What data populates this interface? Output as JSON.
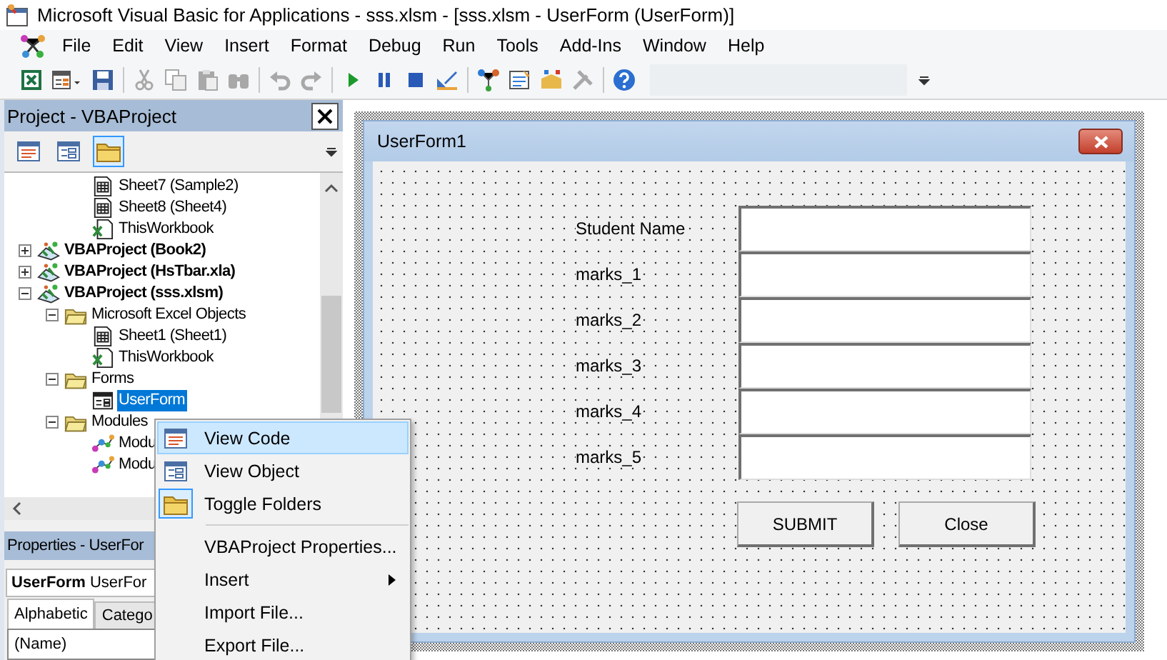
{
  "window": {
    "title": "Microsoft Visual Basic for Applications - sss.xlsm - [sss.xlsm - UserForm (UserForm)]"
  },
  "menu_bar": [
    "File",
    "Edit",
    "View",
    "Insert",
    "Format",
    "Debug",
    "Run",
    "Tools",
    "Add-Ins",
    "Window",
    "Help"
  ],
  "toolbar": [
    {
      "kind": "excel",
      "disabled": false
    },
    {
      "kind": "insert-form",
      "disabled": false
    },
    {
      "kind": "save",
      "disabled": false
    },
    {
      "kind": "separator"
    },
    {
      "kind": "cut",
      "disabled": true
    },
    {
      "kind": "copy",
      "disabled": true
    },
    {
      "kind": "paste",
      "disabled": true
    },
    {
      "kind": "find",
      "disabled": true
    },
    {
      "kind": "separator"
    },
    {
      "kind": "undo",
      "disabled": true
    },
    {
      "kind": "redo",
      "disabled": true
    },
    {
      "kind": "separator"
    },
    {
      "kind": "run",
      "disabled": false
    },
    {
      "kind": "pause",
      "disabled": false
    },
    {
      "kind": "stop",
      "disabled": false
    },
    {
      "kind": "design",
      "disabled": false
    },
    {
      "kind": "separator"
    },
    {
      "kind": "project",
      "disabled": false
    },
    {
      "kind": "properties",
      "disabled": false
    },
    {
      "kind": "object-browser",
      "disabled": false
    },
    {
      "kind": "toolbox",
      "disabled": true
    },
    {
      "kind": "separator"
    },
    {
      "kind": "help",
      "disabled": false
    }
  ],
  "project_pane": {
    "title": "Project - VBAProject",
    "toolbar": [
      {
        "kind": "code",
        "selected": false
      },
      {
        "kind": "object",
        "selected": false
      },
      {
        "kind": "folder",
        "selected": true
      }
    ],
    "tree": [
      {
        "children": [
          {
            "children": [
              {
                "label": "Sheet7 (Sample2)",
                "kind": "sheet",
                "selected": false
              },
              {
                "label": "Sheet8 (Sheet4)",
                "kind": "sheet",
                "selected": false
              },
              {
                "label": "ThisWorkbook",
                "kind": "workbook",
                "selected": false
              }
            ]
          }
        ]
      },
      {
        "label": "VBAProject (Book2)",
        "kind": "project",
        "expanded": false,
        "selected": false
      },
      {
        "label": "VBAProject (HsTbar.xla)",
        "kind": "project",
        "expanded": false,
        "selected": false
      },
      {
        "label": "VBAProject (sss.xlsm)",
        "kind": "project",
        "expanded": true,
        "selected": false,
        "children": [
          {
            "label": "Microsoft Excel Objects",
            "kind": "folder",
            "expanded": true,
            "selected": false,
            "children": [
              {
                "label": "Sheet1 (Sheet1)",
                "kind": "sheet",
                "selected": false
              },
              {
                "label": "ThisWorkbook",
                "kind": "workbook",
                "selected": false
              }
            ]
          },
          {
            "label": "Forms",
            "kind": "folder",
            "expanded": true,
            "selected": false,
            "children": [
              {
                "label": "UserForm",
                "kind": "form",
                "selected": true
              }
            ]
          },
          {
            "label": "Modules",
            "kind": "folder",
            "expanded": true,
            "selected": false,
            "children": [
              {
                "label": "Modu",
                "kind": "module",
                "selected": false
              },
              {
                "label": "Modu",
                "kind": "module",
                "selected": false
              }
            ]
          }
        ]
      }
    ]
  },
  "properties_pane": {
    "title": "Properties - UserFor",
    "object_name": "UserForm",
    "object_type": "UserFor",
    "tabs": [
      {
        "label": "Alphabetic",
        "selected": true
      },
      {
        "label": "Catego",
        "selected": false
      }
    ],
    "rows": [
      "(Name)"
    ]
  },
  "userform": {
    "title": "UserForm1",
    "fields": [
      {
        "label": "Student Name"
      },
      {
        "label": "marks_1"
      },
      {
        "label": "marks_2"
      },
      {
        "label": "marks_3"
      },
      {
        "label": "marks_4"
      },
      {
        "label": "marks_5"
      }
    ],
    "buttons": [
      "SUBMIT",
      "Close"
    ]
  },
  "context_menu": [
    {
      "label": "View Code",
      "kind": "code",
      "selected": true,
      "checked": false
    },
    {
      "label": "View Object",
      "kind": "object",
      "selected": false,
      "checked": false
    },
    {
      "label": "Toggle Folders",
      "kind": "folder",
      "selected": false,
      "checked": true
    },
    {
      "kind": "separator"
    },
    {
      "label": "VBAProject Properties...",
      "kind": "plain",
      "selected": false,
      "checked": false
    },
    {
      "label": "Insert",
      "kind": "submenu",
      "selected": false,
      "checked": false
    },
    {
      "label": "Import File...",
      "kind": "plain",
      "selected": false,
      "checked": false
    },
    {
      "label": "Export File...",
      "kind": "plain",
      "selected": false,
      "checked": false
    }
  ]
}
